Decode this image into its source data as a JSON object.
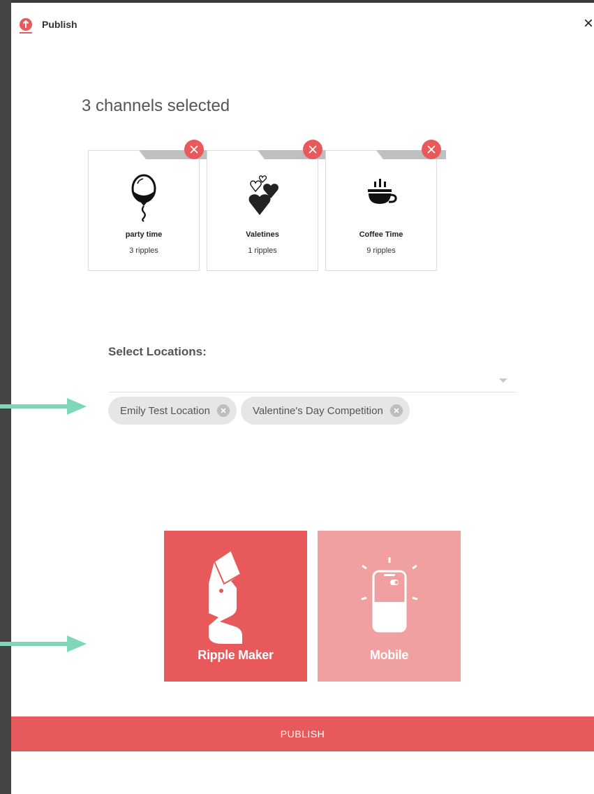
{
  "header": {
    "title": "Publish",
    "close_label": "×"
  },
  "selection": {
    "title": "3 channels selected"
  },
  "channels": [
    {
      "name": "party time",
      "count": "3 ripples",
      "icon": "balloon-icon"
    },
    {
      "name": "Valetines",
      "count": "1 ripples",
      "icon": "hearts-icon"
    },
    {
      "name": "Coffee Time",
      "count": "9 ripples",
      "icon": "coffee-cup-icon"
    }
  ],
  "locations": {
    "label": "Select Locations:",
    "selected": [
      "Emily Test Location",
      "Valentine's Day Competition"
    ]
  },
  "targets": [
    {
      "label": "Ripple Maker",
      "icon": "ripple-maker-icon",
      "color": "#e8595b",
      "selected": true
    },
    {
      "label": "Mobile",
      "icon": "mobile-phone-icon",
      "color": "#f0a0a0",
      "selected": false
    }
  ],
  "footer": {
    "publish_label": "PUBLISH"
  },
  "colors": {
    "accent": "#e8595b",
    "accent_light": "#f0a0a0",
    "annotation_arrow": "#7ed8b7"
  }
}
